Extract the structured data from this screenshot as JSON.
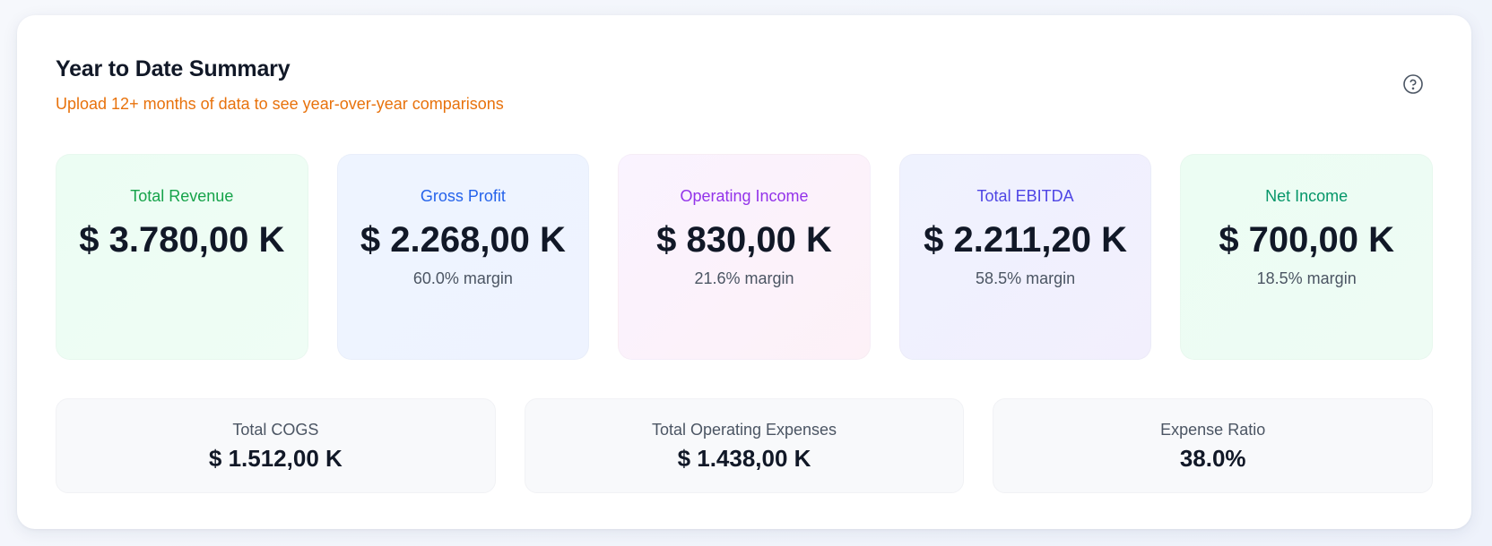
{
  "header": {
    "title": "Year to Date Summary",
    "subtitle": "Upload 12+ months of data to see year-over-year comparisons",
    "help_icon": "question-circle-icon"
  },
  "metrics": [
    {
      "label": "Total Revenue",
      "value": "$ 3.780,00 K",
      "margin": ""
    },
    {
      "label": "Gross Profit",
      "value": "$ 2.268,00 K",
      "margin": "60.0% margin"
    },
    {
      "label": "Operating Income",
      "value": "$ 830,00 K",
      "margin": "21.6% margin"
    },
    {
      "label": "Total EBITDA",
      "value": "$ 2.211,20 K",
      "margin": "58.5% margin"
    },
    {
      "label": "Net Income",
      "value": "$ 700,00 K",
      "margin": "18.5% margin"
    }
  ],
  "secondary": [
    {
      "label": "Total COGS",
      "value": "$ 1.512,00 K"
    },
    {
      "label": "Total Operating Expenses",
      "value": "$ 1.438,00 K"
    },
    {
      "label": "Expense Ratio",
      "value": "38.0%"
    }
  ],
  "colors": {
    "subtitle": "#e8720c",
    "revenue": "#16a34a",
    "gross_profit": "#2563eb",
    "operating_income": "#9333ea",
    "ebitda": "#4f46e5",
    "net_income": "#059669"
  }
}
